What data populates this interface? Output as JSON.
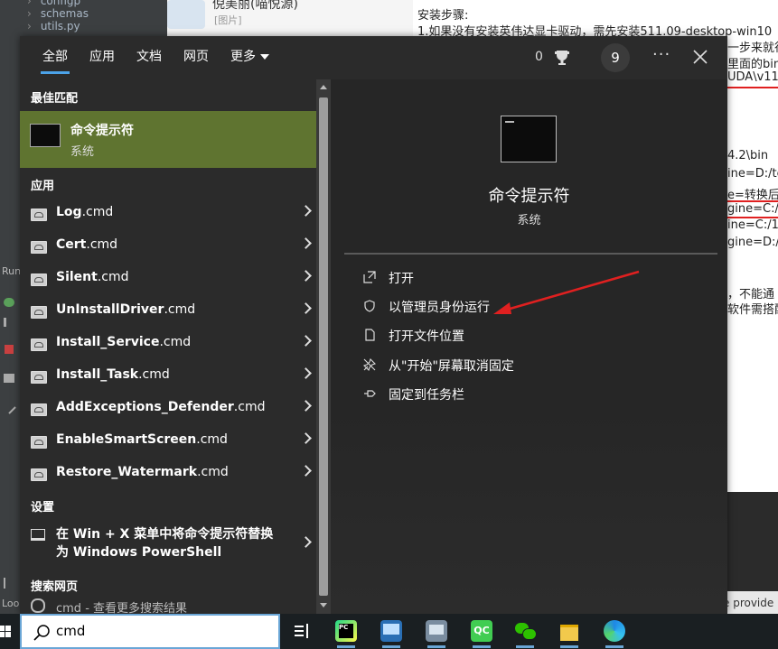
{
  "background": {
    "ide_tree": [
      "configp",
      "schemas",
      "utils.py"
    ],
    "ide_left_labels": [
      "Run",
      "Loo"
    ],
    "chat": {
      "name": "倪美丽(喵悦源)",
      "sub": "[图片]"
    },
    "doc": {
      "title": "安装步骤:",
      "line1": "1.如果没有安装英伟达显卡驱动，需先安装511.09-desktop-win10",
      "frag_a": "一步来就行",
      "frag_b": "里面的bin",
      "frag_c": "UDA\\v11",
      "frag_d": "4.2\\bin",
      "frag_e": "ine=D:/te",
      "frag_f": "e=转换后",
      "frag_g": "gine=C:/1",
      "frag_h": "ine=C:/1.",
      "frag_i": "gine=D:/",
      "frag_j": "，不能通",
      "frag_k": "软件需搭配"
    },
    "bottom_right": "e provide"
  },
  "tabs": [
    {
      "label": "全部",
      "active": true
    },
    {
      "label": "应用",
      "active": false
    },
    {
      "label": "文档",
      "active": false
    },
    {
      "label": "网页",
      "active": false
    },
    {
      "label": "更多",
      "active": false
    }
  ],
  "header": {
    "points": "0",
    "badge": "9",
    "more": "···"
  },
  "left": {
    "best_match_heading": "最佳匹配",
    "best_match": {
      "title": "命令提示符",
      "subtitle": "系统"
    },
    "apps_heading": "应用",
    "apps": [
      {
        "name": "Log",
        "ext": ".cmd"
      },
      {
        "name": "Cert",
        "ext": ".cmd"
      },
      {
        "name": "Silent",
        "ext": ".cmd"
      },
      {
        "name": "UnInstallDriver",
        "ext": ".cmd"
      },
      {
        "name": "Install_Service",
        "ext": ".cmd"
      },
      {
        "name": "Install_Task",
        "ext": ".cmd"
      },
      {
        "name": "AddExceptions_Defender",
        "ext": ".cmd"
      },
      {
        "name": "EnableSmartScreen",
        "ext": ".cmd"
      },
      {
        "name": "Restore_Watermark",
        "ext": ".cmd"
      }
    ],
    "settings_heading": "设置",
    "setting_item": "在 Win + X 菜单中将命令提示符替换为 Windows PowerShell",
    "web_heading": "搜索网页",
    "web_item": "cmd - 查看更多搜索结果"
  },
  "right": {
    "title": "命令提示符",
    "subtitle": "系统",
    "actions": [
      {
        "label": "打开",
        "icon": "open-icon"
      },
      {
        "label": "以管理员身份运行",
        "icon": "shield-icon"
      },
      {
        "label": "打开文件位置",
        "icon": "file-location-icon"
      },
      {
        "label": "从\"开始\"屏幕取消固定",
        "icon": "unpin-icon"
      },
      {
        "label": "固定到任务栏",
        "icon": "pin-icon"
      }
    ]
  },
  "taskbar": {
    "search_value": "cmd",
    "icons": [
      "task-view-icon",
      "pycharm-icon",
      "remote-desktop-icon",
      "network-icon",
      "qt-creator-icon",
      "wechat-icon",
      "file-explorer-icon",
      "edge-icon"
    ]
  },
  "colors": {
    "accent": "#4ca3e8",
    "best_match_bg": "#5f7430",
    "annotation_arrow": "#e02020"
  }
}
